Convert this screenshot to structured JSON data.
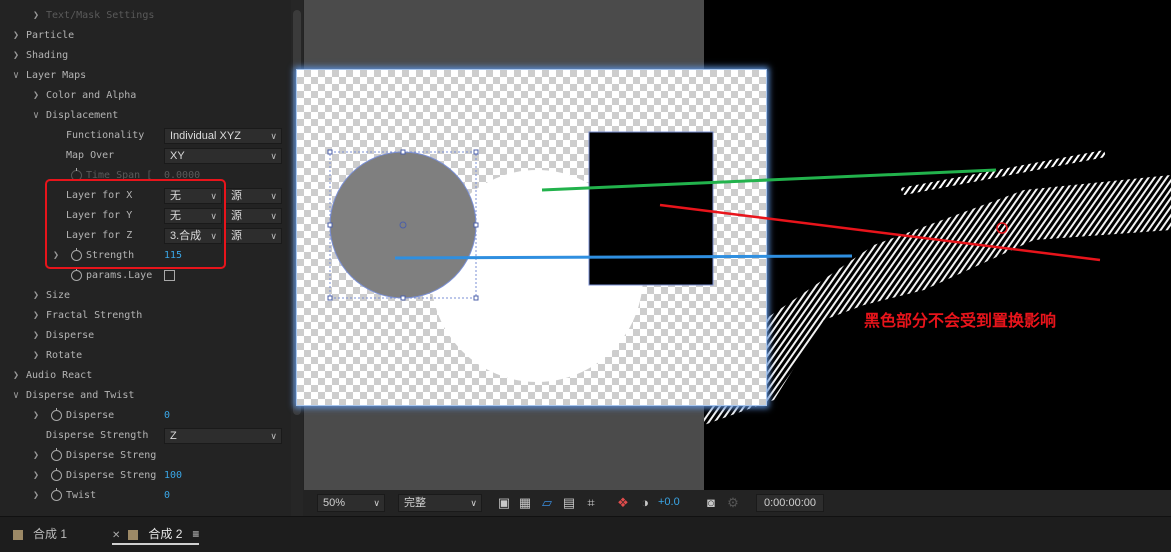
{
  "effect_controls": {
    "text_mask_settings": "Text/Mask Settings",
    "particle": "Particle",
    "shading": "Shading",
    "layer_maps": "Layer Maps",
    "color_and_alpha": "Color and Alpha",
    "displacement": "Displacement",
    "functionality_label": "Functionality",
    "functionality_value": "Individual XYZ",
    "map_over_label": "Map Over",
    "map_over_value": "XY",
    "time_span_label": "Time Span [",
    "time_span_value": "0.0000",
    "layer_for_x_label": "Layer for X",
    "layer_for_x_value": "无",
    "layer_for_x_source": "源",
    "layer_for_y_label": "Layer for Y",
    "layer_for_y_value": "无",
    "layer_for_y_source": "源",
    "layer_for_z_label": "Layer for Z",
    "layer_for_z_value": "3.合成",
    "layer_for_z_source": "源",
    "strength_label": "Strength",
    "strength_value": "115",
    "params_label": "params.Laye",
    "size": "Size",
    "fractal_strength": "Fractal Strength",
    "disperse": "Disperse",
    "rotate": "Rotate",
    "audio_react": "Audio React",
    "disperse_and_twist": "Disperse and Twist",
    "disperse_label": "Disperse",
    "disperse_value": "0",
    "disperse_strength_label": "Disperse Strength",
    "disperse_strength_value": "Z",
    "disperse_streng_1_label": "Disperse Streng",
    "disperse_streng_2_label": "Disperse Streng",
    "disperse_streng_2_value": "100",
    "twist_label": "Twist",
    "twist_value": "0"
  },
  "viewer_toolbar": {
    "zoom": "50%",
    "resolution": "完整",
    "exposure": "+0.0",
    "timecode": "0:00:00:00"
  },
  "annotation": "黑色部分不会受到置换影响",
  "tabs": [
    {
      "label": "合成 1"
    },
    {
      "label": "合成 2"
    }
  ],
  "colors": {
    "highlight_box": "#e8141b",
    "green_line": "#22b24c",
    "red_line": "#e8141b",
    "blue_line": "#2f8fe0",
    "value_blue": "#3aa6e6"
  }
}
